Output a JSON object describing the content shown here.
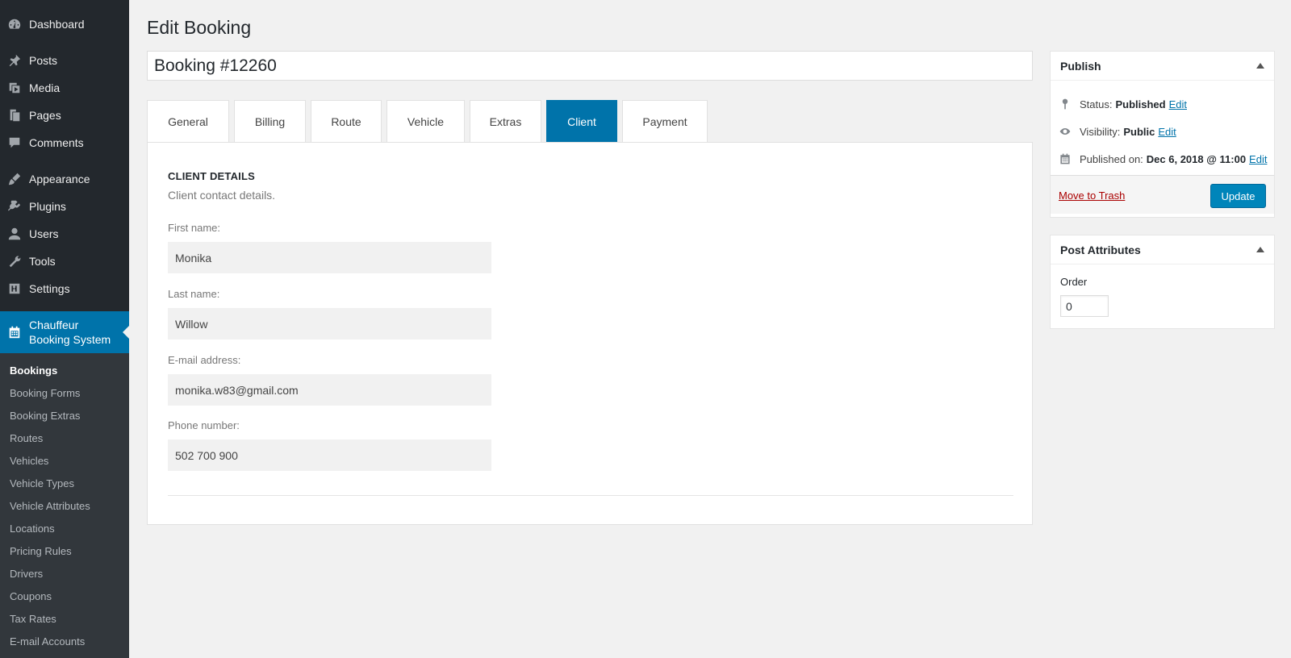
{
  "sidebar": {
    "items": [
      {
        "label": "Dashboard",
        "icon": "dashboard-icon"
      },
      {
        "label": "Posts",
        "icon": "pin-icon"
      },
      {
        "label": "Media",
        "icon": "media-icon"
      },
      {
        "label": "Pages",
        "icon": "pages-icon"
      },
      {
        "label": "Comments",
        "icon": "comment-icon"
      },
      {
        "label": "Appearance",
        "icon": "brush-icon"
      },
      {
        "label": "Plugins",
        "icon": "plugin-icon"
      },
      {
        "label": "Users",
        "icon": "user-icon"
      },
      {
        "label": "Tools",
        "icon": "wrench-icon"
      },
      {
        "label": "Settings",
        "icon": "settings-icon"
      }
    ],
    "active": {
      "label_line1": "Chauffeur",
      "label_line2": "Booking System",
      "icon": "calendar-icon"
    },
    "submenu": [
      "Bookings",
      "Booking Forms",
      "Booking Extras",
      "Routes",
      "Vehicles",
      "Vehicle Types",
      "Vehicle Attributes",
      "Locations",
      "Pricing Rules",
      "Drivers",
      "Coupons",
      "Tax Rates",
      "E-mail Accounts"
    ]
  },
  "main": {
    "page_title": "Edit Booking",
    "post_title": "Booking #12260",
    "tabs": [
      "General",
      "Billing",
      "Route",
      "Vehicle",
      "Extras",
      "Client",
      "Payment"
    ],
    "active_tab": "Client",
    "section_title": "CLIENT DETAILS",
    "section_subtitle": "Client contact details.",
    "fields": [
      {
        "label": "First name:",
        "value": "Monika"
      },
      {
        "label": "Last name:",
        "value": "Willow"
      },
      {
        "label": "E-mail address:",
        "value": "monika.w83@gmail.com"
      },
      {
        "label": "Phone number:",
        "value": "502 700 900"
      }
    ]
  },
  "publish": {
    "title": "Publish",
    "status_label": "Status:",
    "status_value": "Published",
    "visibility_label": "Visibility:",
    "visibility_value": "Public",
    "published_label": "Published on:",
    "published_value": "Dec 6, 2018 @ 11:00",
    "edit_label": "Edit",
    "trash_label": "Move to Trash",
    "update_label": "Update"
  },
  "attributes": {
    "title": "Post Attributes",
    "order_label": "Order",
    "order_value": "0"
  },
  "colors": {
    "accent": "#0073aa",
    "sidebar_bg": "#23282d",
    "submenu_bg": "#32373c",
    "trash": "#a00"
  }
}
